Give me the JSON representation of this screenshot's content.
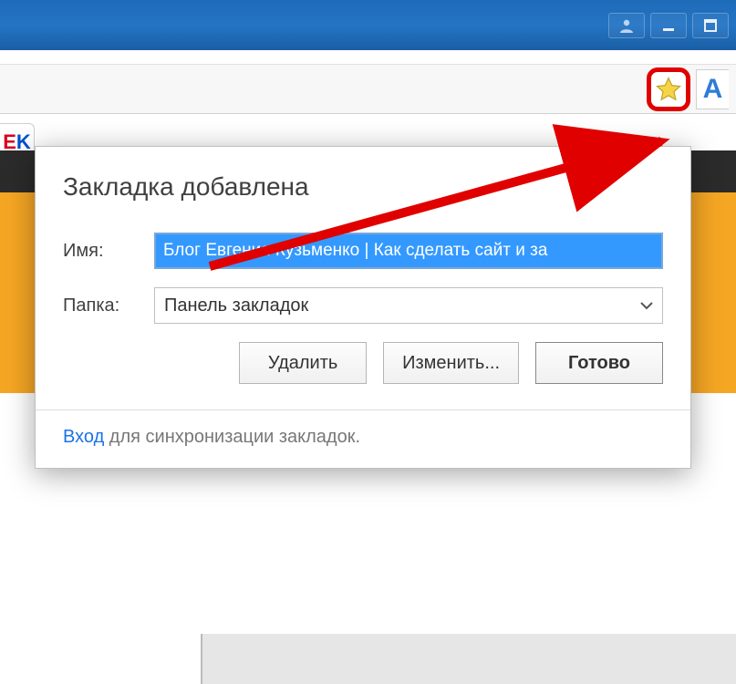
{
  "titlebar": {
    "user_btn": "user",
    "minimize_btn": "minimize",
    "maximize_btn": "maximize"
  },
  "addressbar": {
    "ext_label": "A",
    "ek_e": "E",
    "ek_k": "K"
  },
  "popup": {
    "title": "Закладка добавлена",
    "name_label": "Имя:",
    "name_value": "Блог Евгения Кузьменко | Как сделать сайт и за",
    "folder_label": "Папка:",
    "folder_value": "Панель закладок",
    "delete_btn": "Удалить",
    "edit_btn": "Изменить...",
    "done_btn": "Готово",
    "sync_link": "Вход",
    "sync_rest": " для синхронизации закладок."
  }
}
